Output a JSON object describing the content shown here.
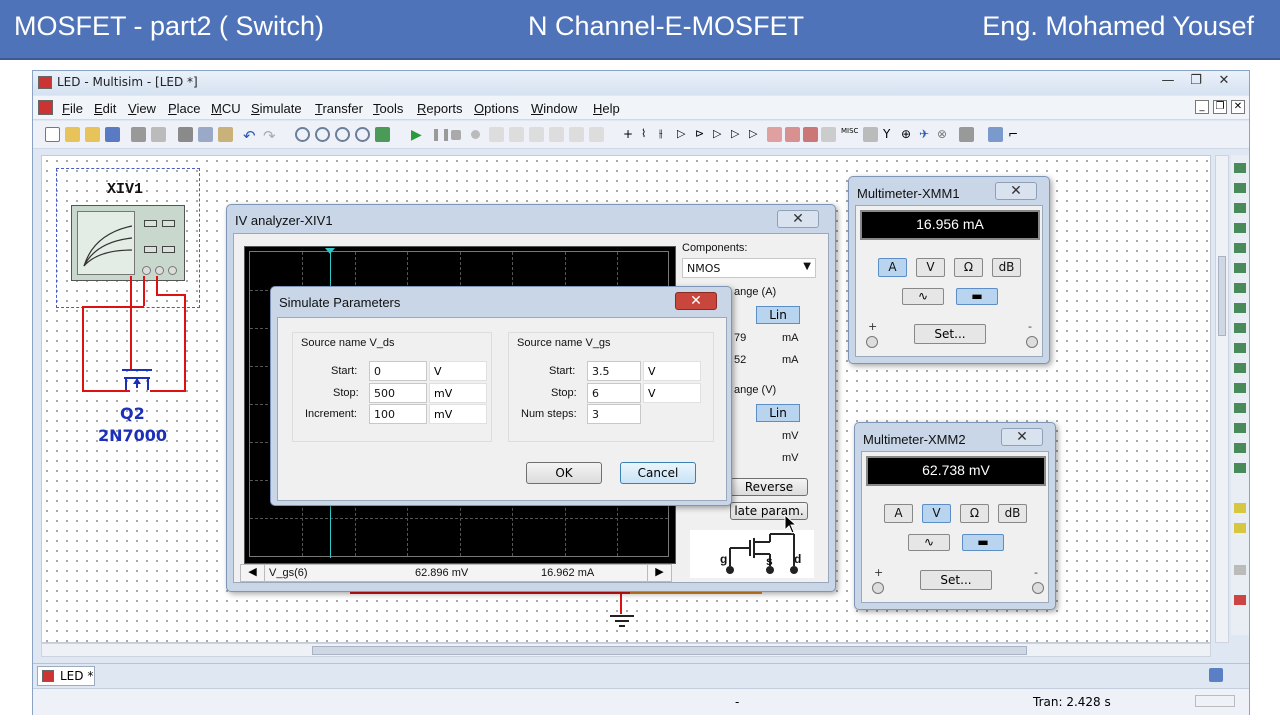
{
  "slide": {
    "left_title": "MOSFET  - part2  ( Switch)",
    "center_title": "N Channel-E-MOSFET",
    "right_title": "Eng. Mohamed Yousef"
  },
  "window": {
    "title": "LED - Multisim - [LED *]"
  },
  "menu": [
    "File",
    "Edit",
    "View",
    "Place",
    "MCU",
    "Simulate",
    "Transfer",
    "Tools",
    "Reports",
    "Options",
    "Window",
    "Help"
  ],
  "schematic": {
    "instrument_label": "XIV1",
    "transistor_ref": "Q2",
    "transistor_model": "2N7000"
  },
  "iv_analyzer": {
    "title": "IV analyzer-XIV1",
    "components_label": "Components:",
    "component_value": "NMOS",
    "current_range_label": "ange (A)",
    "current_scale": "Lin",
    "current_val_1": "79",
    "current_unit_1": "mA",
    "current_val_2": "52",
    "current_unit_2": "mA",
    "voltage_range_label": "ange (V)",
    "voltage_scale": "Lin",
    "voltage_unit_1": "mV",
    "voltage_unit_2": "mV",
    "reverse_label": "Reverse",
    "sim_param_label": "late param.",
    "cursor_series": "V_gs(6)",
    "cursor_voltage": "62.896 mV",
    "cursor_current": "16.962 mA",
    "terminals": [
      "g",
      "s",
      "d"
    ]
  },
  "sim_params": {
    "title": "Simulate Parameters",
    "vds": {
      "header": "Source name V_ds",
      "start_label": "Start:",
      "start": "0",
      "start_unit": "V",
      "stop_label": "Stop:",
      "stop": "500",
      "stop_unit": "mV",
      "inc_label": "Increment:",
      "inc": "100",
      "inc_unit": "mV"
    },
    "vgs": {
      "header": "Source name V_gs",
      "start_label": "Start:",
      "start": "3.5",
      "start_unit": "V",
      "stop_label": "Stop:",
      "stop": "6",
      "stop_unit": "V",
      "steps_label": "Num steps:",
      "steps": "3"
    },
    "ok": "OK",
    "cancel": "Cancel"
  },
  "mm1": {
    "title": "Multimeter-XMM1",
    "reading": "16.956 mA",
    "modes": [
      "A",
      "V",
      "Ω",
      "dB"
    ],
    "active_mode": "A",
    "set": "Set...",
    "plus": "+",
    "minus": "-"
  },
  "mm2": {
    "title": "Multimeter-XMM2",
    "reading": "62.738 mV",
    "modes": [
      "A",
      "V",
      "Ω",
      "dB"
    ],
    "active_mode": "V",
    "set": "Set...",
    "plus": "+",
    "minus": "-"
  },
  "tab": {
    "label": "LED *"
  },
  "status": {
    "middle": "-",
    "tran": "Tran: 2.428 s"
  },
  "colors": {
    "header_bg": "#4f73b8",
    "wire": "#dd1111",
    "component": "#1b2fb8"
  }
}
